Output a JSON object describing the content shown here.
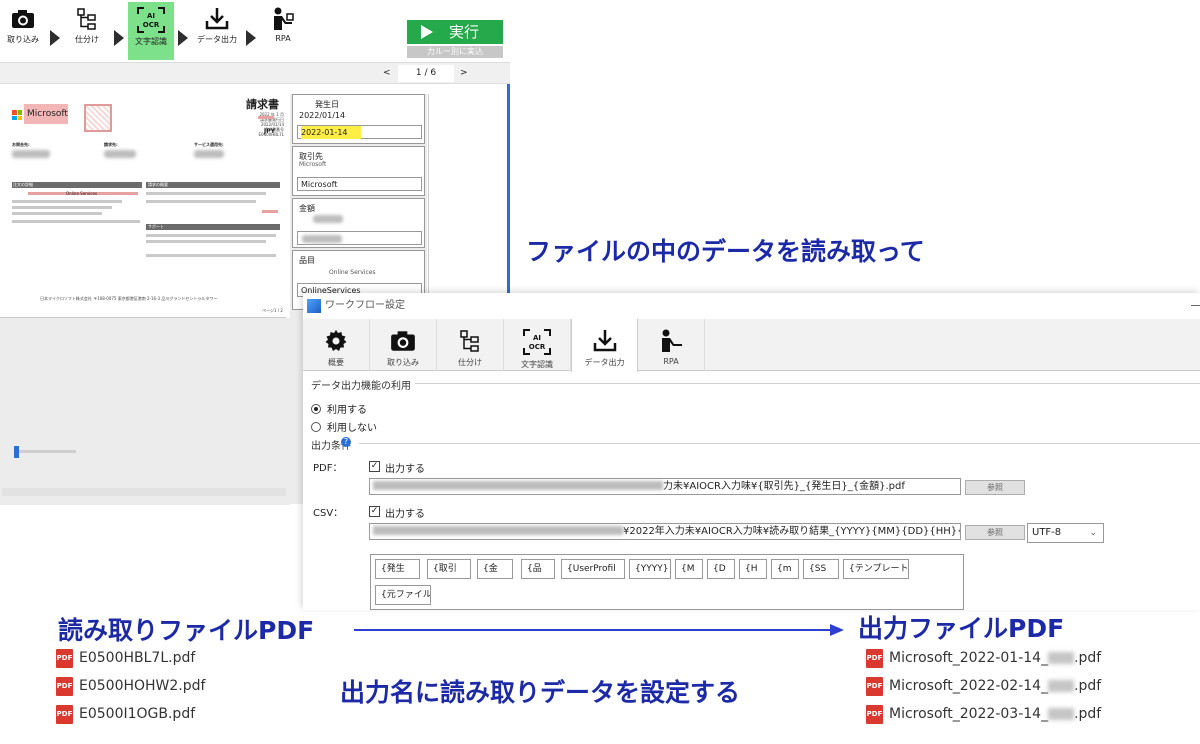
{
  "app": {
    "toolbar": [
      {
        "id": "import",
        "label": "取り込み",
        "icon": "camera-icon"
      },
      {
        "id": "sort",
        "label": "仕分け",
        "icon": "sort-tree-icon"
      },
      {
        "id": "ocr",
        "label": "文字認識",
        "icon": "ai-ocr-icon",
        "active": true
      },
      {
        "id": "export",
        "label": "データ出力",
        "icon": "download-icon"
      },
      {
        "id": "rpa",
        "label": "RPA",
        "icon": "rpa-person-icon"
      }
    ],
    "run_label": "実行",
    "run_sub_label": "力ルー別に実込",
    "ocr_icon_text": [
      "AI",
      "OCR"
    ],
    "pager": {
      "prev": "<",
      "page": "1",
      "sep": "/",
      "total": "6",
      "next": ">"
    },
    "preview": {
      "title": "請求書",
      "company": "Microsoft",
      "meta_lines": [
        "2022 年 1 月",
        "請求書発行日 2022/01/14",
        "請求書番号 E0500HBL7L"
      ],
      "currency": "JPY",
      "labels": [
        "お問合先:",
        "請求先:",
        "サービス適用先:"
      ],
      "section_headers": [
        "注文の詳細",
        "請求の概要"
      ],
      "item": "Online Services",
      "contact_header": "サポート",
      "footer_addr": "日本マイクロソフト株式会社 〒108-0075 東京都港区港南 2-16-3 品川グランドセントラルタワー",
      "page_no": "ページ1 / 2"
    },
    "fields": [
      {
        "label": "発生日",
        "read": "2022/01/14",
        "value": "2022-01-14",
        "highlight": true
      },
      {
        "label": "取引先",
        "read": "Microsoft",
        "value": "Microsoft"
      },
      {
        "label": "金額",
        "read": "",
        "value": ""
      },
      {
        "label": "品目",
        "read": "Online Services",
        "value": "OnlineServices"
      }
    ]
  },
  "dialog": {
    "title": "ワークフロー設定",
    "tabs": [
      {
        "label": "概要",
        "icon": "gear-icon"
      },
      {
        "label": "取り込み",
        "icon": "camera-icon"
      },
      {
        "label": "仕分け",
        "icon": "sort-tree-icon"
      },
      {
        "label": "文字認識",
        "icon": "ai-ocr-icon"
      },
      {
        "label": "データ出力",
        "icon": "download-icon",
        "selected": true
      },
      {
        "label": "RPA",
        "icon": "rpa-person-icon"
      }
    ],
    "group_use": "データ出力機能の利用",
    "radio_use": "利用する",
    "radio_nouse": "利用しない",
    "group_cond": "出力条件",
    "help_icon": "?",
    "pdf": {
      "label": "PDF：",
      "checkbox": "出力する",
      "path_tail": "力未¥AIOCR入力味¥{取引先}_{発生日}_{金額}.pdf",
      "browse": "参照"
    },
    "csv": {
      "label": "CSV：",
      "checkbox": "出力する",
      "path_tail": "¥2022年入力未¥AIOCR入力味¥読み取り結果_{YYYY}{MM}{DD}{HH}{mm}.c",
      "browse": "参照",
      "encoding": "UTF-8"
    },
    "tags": [
      "{発生",
      "{取引",
      "{金",
      "{品",
      "{UserProfil",
      "{YYYY}",
      "{M",
      "{D",
      "{H",
      "{m",
      "{SS",
      "{テンプレート",
      "{元ファイル"
    ]
  },
  "annotations": {
    "read_data": "ファイルの中のデータを読み取って",
    "input_title": "読み取りファイルPDF",
    "output_title": "出力ファイルPDF",
    "set_name": "出力名に読み取りデータを設定する",
    "input_files": [
      "E0500HBL7L.pdf",
      "E0500HOHW2.pdf",
      "E0500I1OGB.pdf"
    ],
    "output_files": [
      {
        "prefix": "Microsoft_2022-01-14_",
        "suffix": ".pdf"
      },
      {
        "prefix": "Microsoft_2022-02-14_",
        "suffix": ".pdf"
      },
      {
        "prefix": "Microsoft_2022-03-14_",
        "suffix": ".pdf"
      }
    ],
    "pdf_badge": "PDF"
  },
  "colors": {
    "accent_green": "#25a94a",
    "active_tab": "#7de08b",
    "annotation_blue": "#1c2aa8",
    "highlight_yellow": "#ffee44",
    "pdf_red": "#d9392e"
  }
}
